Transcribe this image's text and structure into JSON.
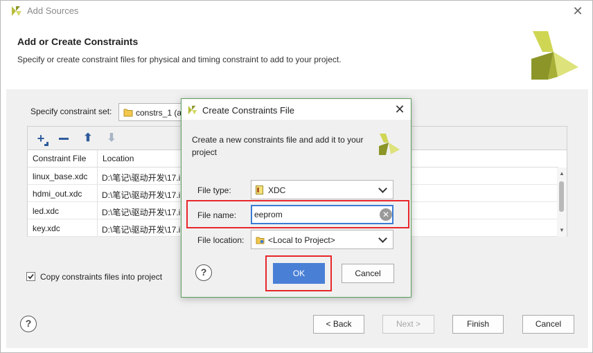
{
  "window": {
    "title": "Add Sources"
  },
  "header": {
    "title": "Add or Create Constraints",
    "description": "Specify or create constraint files for physical and timing constraint to add to your project."
  },
  "constraint_set": {
    "label": "Specify constraint set:",
    "value": "constrs_1 (a"
  },
  "table": {
    "columns": [
      "Constraint File",
      "Location"
    ],
    "rows": [
      {
        "file": "linux_base.xdc",
        "location": "D:\\笔记\\驱动开发\\17.i"
      },
      {
        "file": "hdmi_out.xdc",
        "location": "D:\\笔记\\驱动开发\\17.i"
      },
      {
        "file": "led.xdc",
        "location": "D:\\笔记\\驱动开发\\17.i"
      },
      {
        "file": "key.xdc",
        "location": "D:\\笔记\\驱动开发\\17.i"
      }
    ]
  },
  "copy_checkbox": {
    "label": "Copy constraints files into project",
    "checked": true
  },
  "footer": {
    "help": "?",
    "back": "< Back",
    "next": "Next >",
    "finish": "Finish",
    "cancel": "Cancel"
  },
  "dialog": {
    "title": "Create Constraints File",
    "description": "Create a new constraints file and add it to your project",
    "file_type_label": "File type:",
    "file_type_value": "XDC",
    "file_name_label": "File name:",
    "file_name_value": "eeprom",
    "file_location_label": "File location:",
    "file_location_value": "<Local to Project>",
    "help": "?",
    "ok": "OK",
    "cancel": "Cancel"
  },
  "colors": {
    "ok_button": "#4a7fd6",
    "highlight": "#e8262a",
    "logo_light": "#cfd654",
    "logo_dark": "#8c9628"
  }
}
